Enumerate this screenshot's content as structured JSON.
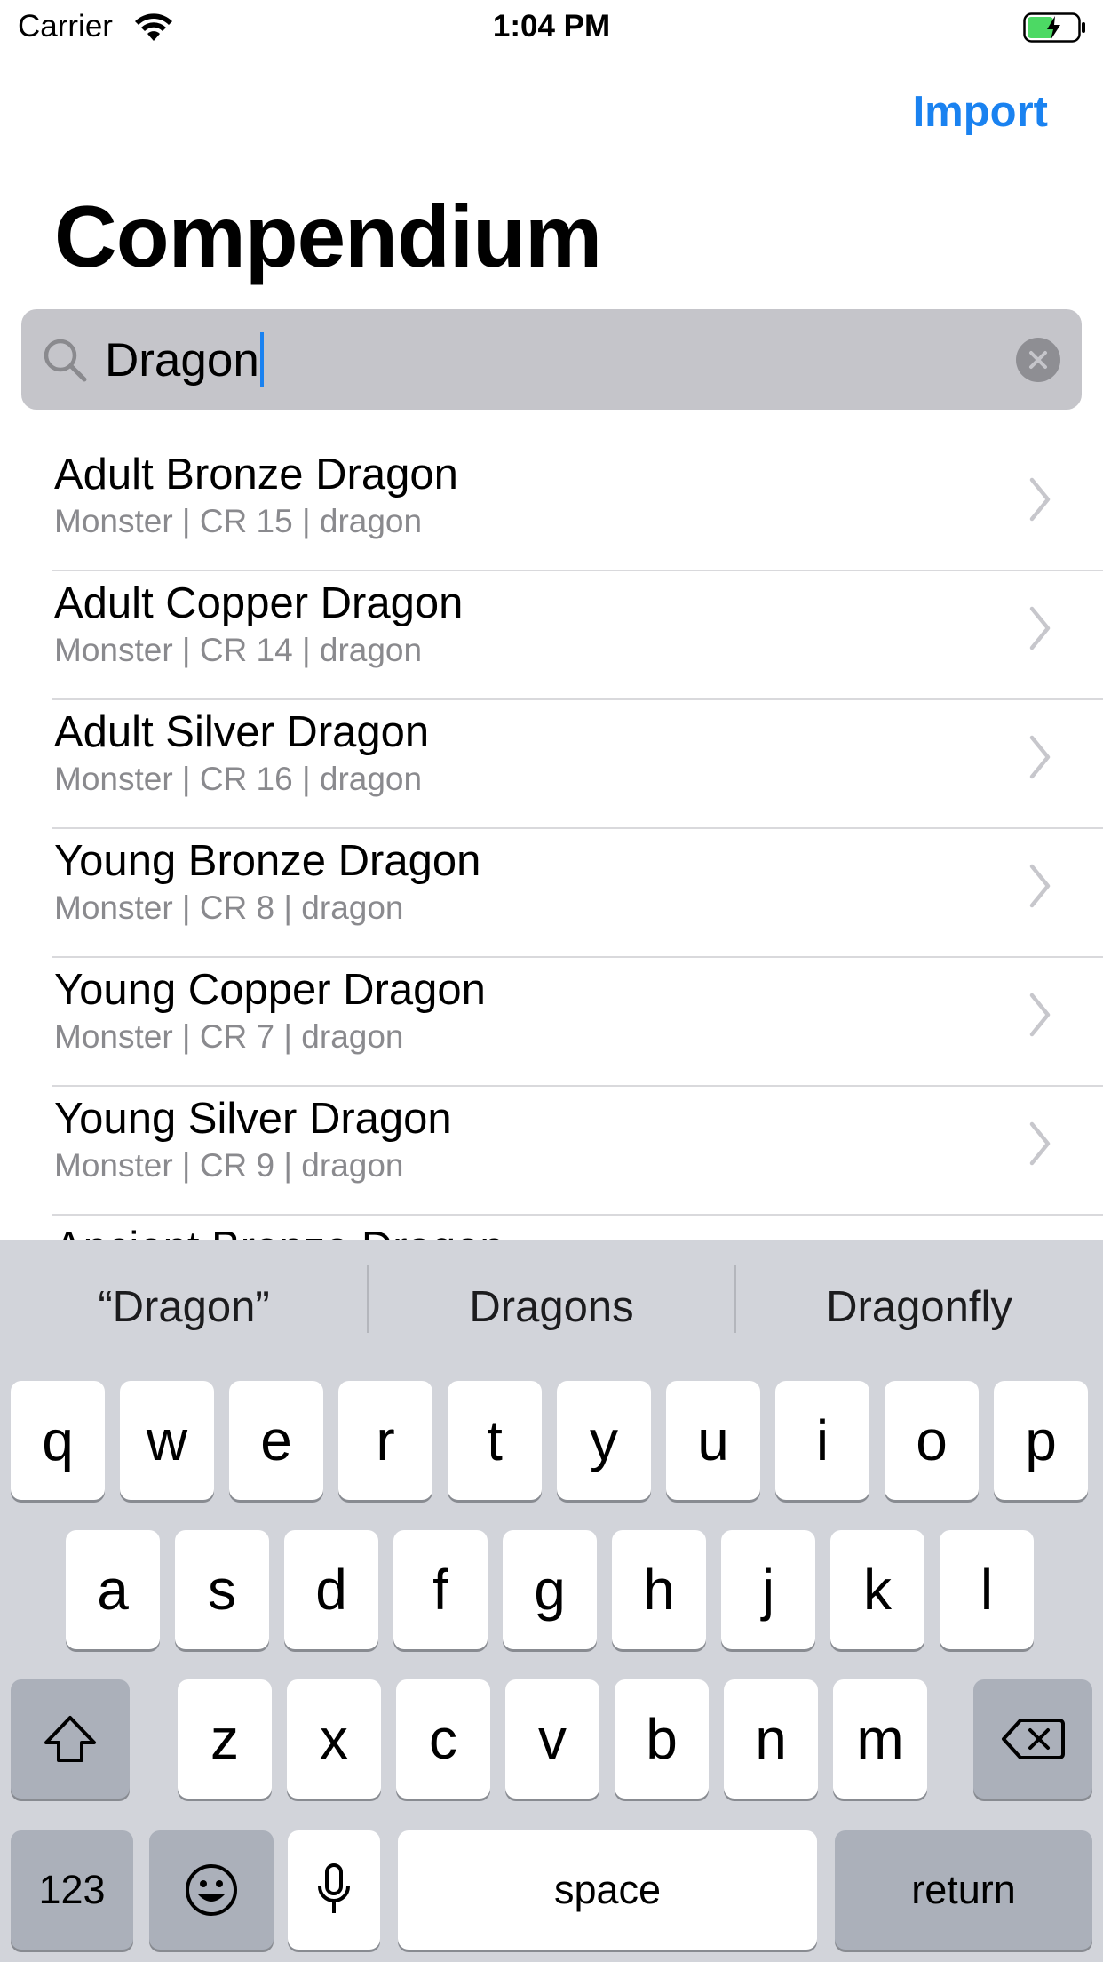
{
  "status_bar": {
    "carrier": "Carrier",
    "time": "1:04 PM"
  },
  "nav": {
    "import_label": "Import",
    "title": "Compendium"
  },
  "search": {
    "value": "Dragon"
  },
  "results": [
    {
      "name": "Adult Bronze Dragon",
      "detail": "Monster | CR 15 | dragon"
    },
    {
      "name": "Adult Copper Dragon",
      "detail": "Monster | CR 14 | dragon"
    },
    {
      "name": "Adult Silver Dragon",
      "detail": "Monster | CR 16 | dragon"
    },
    {
      "name": "Young Bronze Dragon",
      "detail": "Monster | CR 8 | dragon"
    },
    {
      "name": "Young Copper Dragon",
      "detail": "Monster | CR 7 | dragon"
    },
    {
      "name": "Young Silver Dragon",
      "detail": "Monster | CR 9 | dragon"
    },
    {
      "name": "Ancient Bronze Dragon",
      "detail": ""
    }
  ],
  "keyboard": {
    "suggestions": [
      "“Dragon”",
      "Dragons",
      "Dragonfly"
    ],
    "row1": [
      "q",
      "w",
      "e",
      "r",
      "t",
      "y",
      "u",
      "i",
      "o",
      "p"
    ],
    "row2": [
      "a",
      "s",
      "d",
      "f",
      "g",
      "h",
      "j",
      "k",
      "l"
    ],
    "row3": [
      "z",
      "x",
      "c",
      "v",
      "b",
      "n",
      "m"
    ],
    "numbers_label": "123",
    "space_label": "space",
    "return_label": "return"
  },
  "colors": {
    "accent": "#1a82f0",
    "keyboard_bg": "#d2d4da",
    "battery_fill": "#4cd964"
  }
}
